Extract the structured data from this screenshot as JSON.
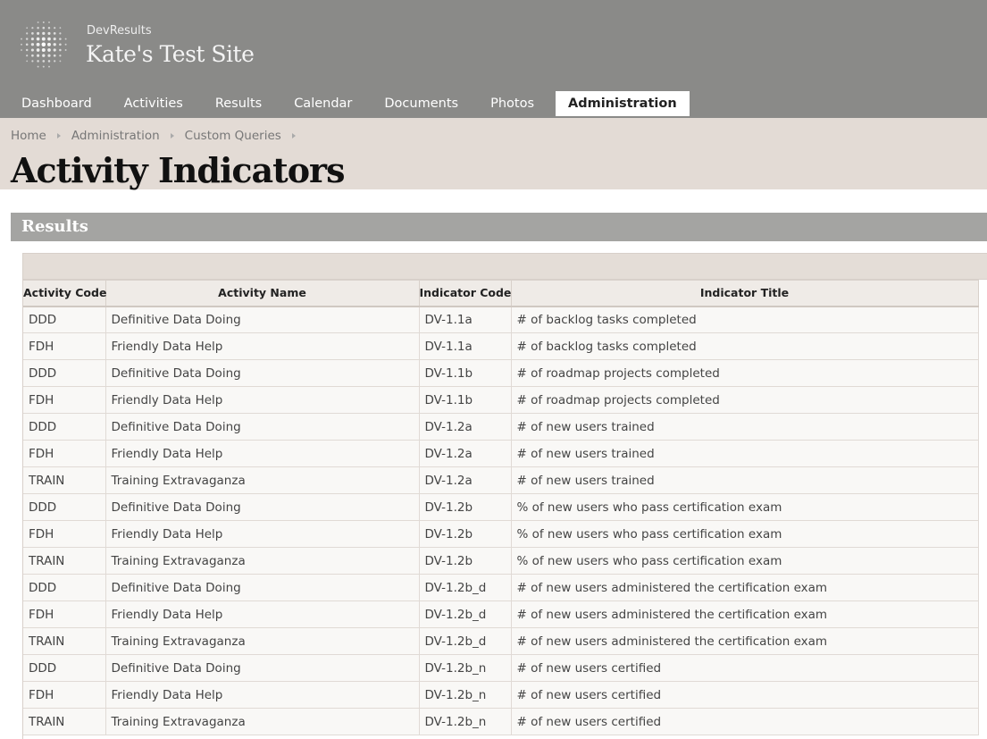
{
  "header": {
    "org_name": "DevResults",
    "site_name": "Kate's Test Site",
    "logo_icon": "globe-dots-icon"
  },
  "nav": {
    "items": [
      {
        "label": "Dashboard"
      },
      {
        "label": "Activities"
      },
      {
        "label": "Results"
      },
      {
        "label": "Calendar"
      },
      {
        "label": "Documents"
      },
      {
        "label": "Photos"
      },
      {
        "label": "Administration",
        "active": true
      }
    ]
  },
  "breadcrumb": [
    "Home",
    "Administration",
    "Custom Queries"
  ],
  "page_title": "Activity Indicators",
  "results": {
    "title": "Results",
    "columns": [
      "Activity Code",
      "Activity Name",
      "Indicator Code",
      "Indicator Title"
    ],
    "rows": [
      [
        "DDD",
        "Definitive Data Doing",
        "DV-1.1a",
        "# of backlog tasks completed"
      ],
      [
        "FDH",
        "Friendly Data Help",
        "DV-1.1a",
        "# of backlog tasks completed"
      ],
      [
        "DDD",
        "Definitive Data Doing",
        "DV-1.1b",
        "# of roadmap projects completed"
      ],
      [
        "FDH",
        "Friendly Data Help",
        "DV-1.1b",
        "# of roadmap projects completed"
      ],
      [
        "DDD",
        "Definitive Data Doing",
        "DV-1.2a",
        "# of new users trained"
      ],
      [
        "FDH",
        "Friendly Data Help",
        "DV-1.2a",
        "# of new users trained"
      ],
      [
        "TRAIN",
        "Training Extravaganza",
        "DV-1.2a",
        "# of new users trained"
      ],
      [
        "DDD",
        "Definitive Data Doing",
        "DV-1.2b",
        "% of new users who pass certification exam"
      ],
      [
        "FDH",
        "Friendly Data Help",
        "DV-1.2b",
        "% of new users who pass certification exam"
      ],
      [
        "TRAIN",
        "Training Extravaganza",
        "DV-1.2b",
        "% of new users who pass certification exam"
      ],
      [
        "DDD",
        "Definitive Data Doing",
        "DV-1.2b_d",
        "# of new users administered the certification exam"
      ],
      [
        "FDH",
        "Friendly Data Help",
        "DV-1.2b_d",
        "# of new users administered the certification exam"
      ],
      [
        "TRAIN",
        "Training Extravaganza",
        "DV-1.2b_d",
        "# of new users administered the certification exam"
      ],
      [
        "DDD",
        "Definitive Data Doing",
        "DV-1.2b_n",
        "# of new users certified"
      ],
      [
        "FDH",
        "Friendly Data Help",
        "DV-1.2b_n",
        "# of new users certified"
      ],
      [
        "TRAIN",
        "Training Extravaganza",
        "DV-1.2b_n",
        "# of new users certified"
      ]
    ]
  }
}
